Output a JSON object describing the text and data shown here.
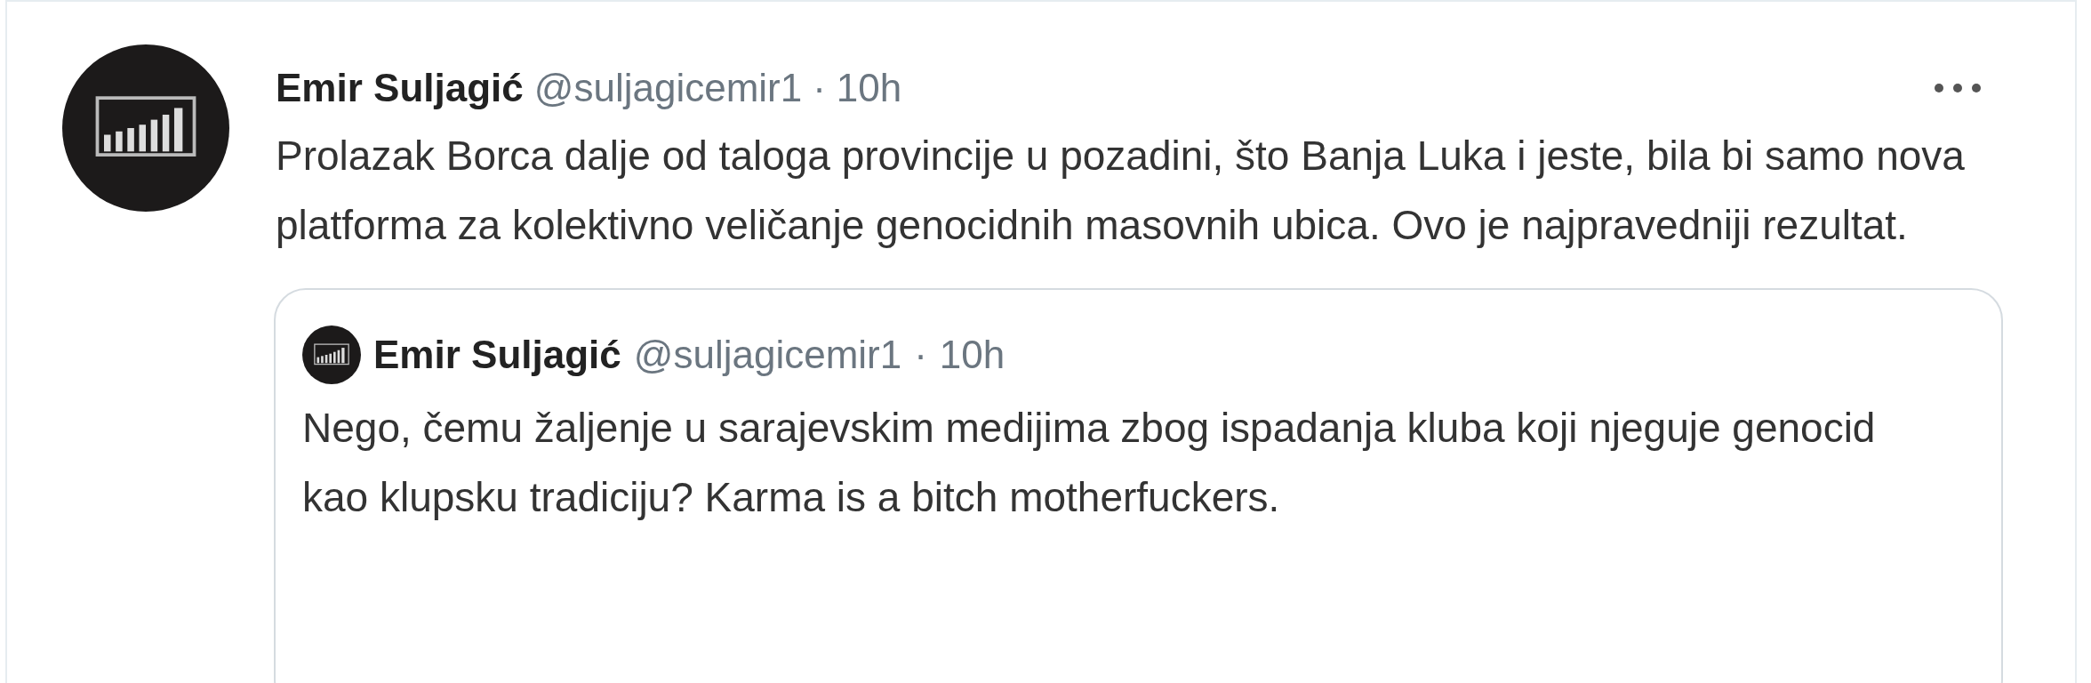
{
  "tweet": {
    "name": "Emir Suljagić",
    "handle": "@suljagicemir1",
    "separator": "·",
    "time": "10h",
    "text": "Prolazak Borca dalje od taloga provincije u pozadini, što Banja Luka i jeste, bila bi samo nova platforma za kolektivno veličanje genocidnih masovnih ubica. Ovo je najpravedniji rezultat."
  },
  "quoted_tweet": {
    "name": "Emir Suljagić",
    "handle": "@suljagicemir1",
    "separator": "·",
    "time": "10h",
    "text": "Nego, čemu žaljenje u sarajevskim medijima zbog ispadanja kluba koji njeguje genocid kao klupsku tradiciju? Karma is a bitch motherfuckers."
  }
}
